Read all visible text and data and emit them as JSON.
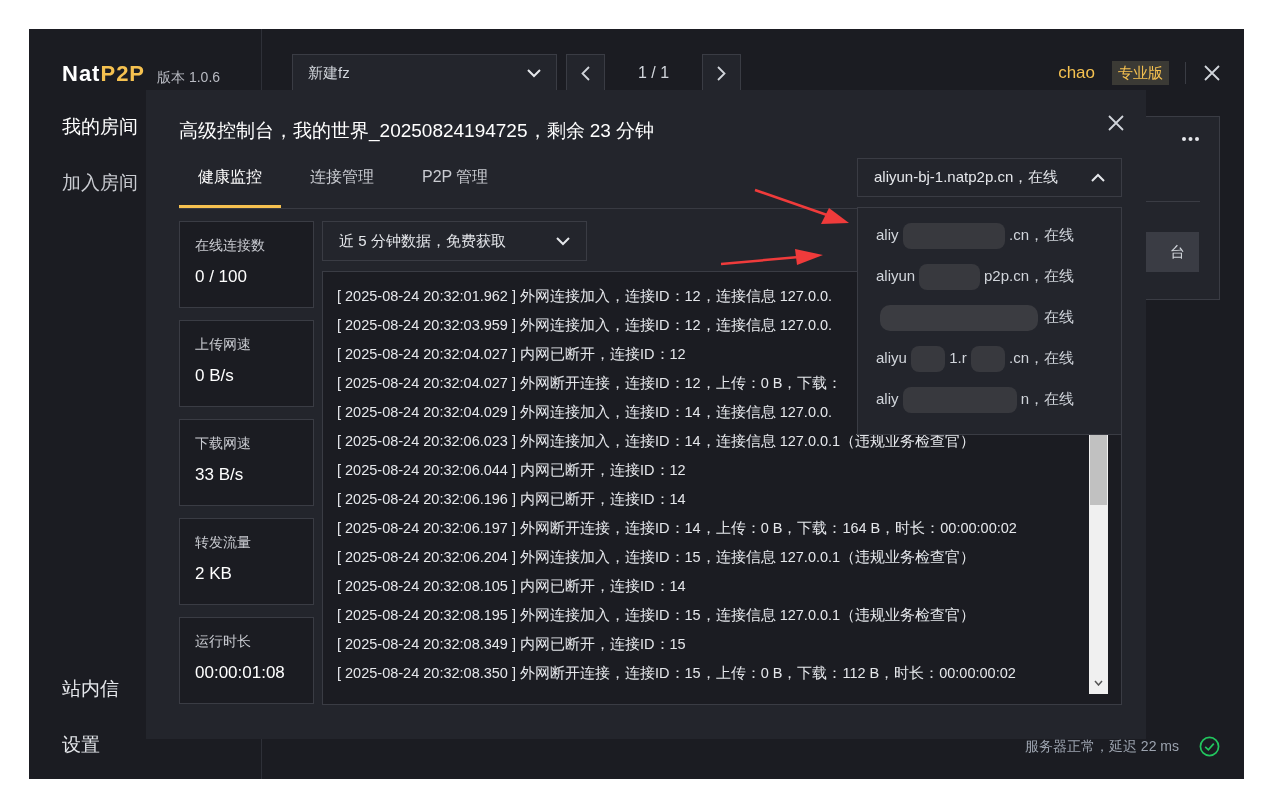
{
  "app": {
    "logo": [
      "Nat",
      "P2P"
    ],
    "version": "版本 1.0.6"
  },
  "sidebar": {
    "items": [
      {
        "label": "我的房间",
        "selected": true
      },
      {
        "label": "加入房间",
        "selected": false
      }
    ],
    "bottom_items": [
      {
        "label": "站内信"
      },
      {
        "label": "设置"
      }
    ]
  },
  "topbar": {
    "room_select": "新建fz",
    "page": "1 / 1",
    "user": "chao",
    "plan": "专业版"
  },
  "background_card": {
    "button": "台"
  },
  "status": {
    "text": "服务器正常，延迟 22 ms",
    "ok": true
  },
  "modal": {
    "title": "高级控制台，我的世界_20250824194725，剩余 23 分钟",
    "tabs": [
      {
        "label": "健康监控",
        "selected": true
      },
      {
        "label": "连接管理",
        "selected": false
      },
      {
        "label": "P2P 管理",
        "selected": false
      }
    ],
    "server_select": {
      "value": "aliyun-bj-1.natp2p.cn，在线",
      "expanded": true
    },
    "server_options": [
      {
        "fragments": [
          "aliy",
          ".cn，在线"
        ]
      },
      {
        "fragments": [
          "aliyun",
          "p2p.cn，在线"
        ]
      },
      {
        "fragments": [
          "在线"
        ]
      },
      {
        "fragments": [
          "aliyu",
          "1.r",
          ".cn，在线"
        ]
      },
      {
        "fragments": [
          "aliy",
          "n，在线"
        ]
      }
    ],
    "stats": [
      {
        "label": "在线连接数",
        "value": "0 / 100"
      },
      {
        "label": "上传网速",
        "value": "0 B/s"
      },
      {
        "label": "下载网速",
        "value": "33 B/s"
      },
      {
        "label": "转发流量",
        "value": "2 KB"
      },
      {
        "label": "运行时长",
        "value": "00:00:01:08"
      }
    ],
    "range_select": "近 5 分钟数据，免费获取",
    "log": [
      "[ 2025-08-24 20:32:01.962 ] 外网连接加入，连接ID：12，连接信息 127.0.0.",
      "[ 2025-08-24 20:32:03.959 ] 外网连接加入，连接ID：12，连接信息 127.0.0.",
      "[ 2025-08-24 20:32:04.027 ] 内网已断开，连接ID：12",
      "[ 2025-08-24 20:32:04.027 ] 外网断开连接，连接ID：12，上传：0 B，下载：",
      "[ 2025-08-24 20:32:04.029 ] 外网连接加入，连接ID：14，连接信息 127.0.0.",
      "[ 2025-08-24 20:32:06.023 ] 外网连接加入，连接ID：14，连接信息 127.0.0.1（违规业务检查官）",
      "[ 2025-08-24 20:32:06.044 ] 内网已断开，连接ID：12",
      "[ 2025-08-24 20:32:06.196 ] 内网已断开，连接ID：14",
      "[ 2025-08-24 20:32:06.197 ] 外网断开连接，连接ID：14，上传：0 B，下载：164 B，时长：00:00:00:02",
      "[ 2025-08-24 20:32:06.204 ] 外网连接加入，连接ID：15，连接信息 127.0.0.1（违规业务检查官）",
      "[ 2025-08-24 20:32:08.105 ] 内网已断开，连接ID：14",
      "[ 2025-08-24 20:32:08.195 ] 外网连接加入，连接ID：15，连接信息 127.0.0.1（违规业务检查官）",
      "[ 2025-08-24 20:32:08.349 ] 内网已断开，连接ID：15",
      "[ 2025-08-24 20:32:08.350 ] 外网断开连接，连接ID：15，上传：0 B，下载：112 B，时长：00:00:00:02"
    ]
  }
}
